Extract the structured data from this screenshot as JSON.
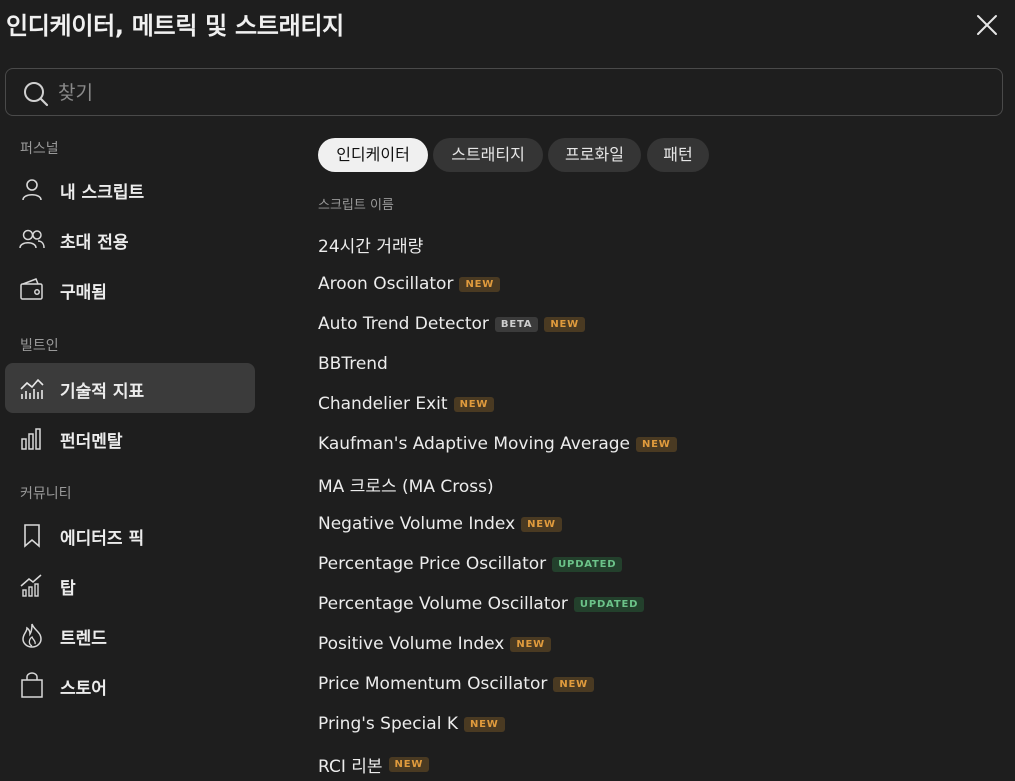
{
  "title": "인디케이터, 메트릭 및 스트래티지",
  "search": {
    "placeholder": "찾기",
    "value": ""
  },
  "sidebar": {
    "personal_heading": "퍼스널",
    "personal_items": [
      {
        "label": "내 스크립트",
        "icon": "user-icon"
      },
      {
        "label": "초대 전용",
        "icon": "users-icon"
      },
      {
        "label": "구매됨",
        "icon": "wallet-icon"
      }
    ],
    "builtin_heading": "빌트인",
    "builtin_items": [
      {
        "label": "기술적 지표",
        "icon": "chart-icon",
        "active": true
      },
      {
        "label": "펀더멘탈",
        "icon": "bars-icon"
      }
    ],
    "community_heading": "커뮤니티",
    "community_items": [
      {
        "label": "에디터즈 픽",
        "icon": "bookmark-icon"
      },
      {
        "label": "탑",
        "icon": "growth-icon"
      },
      {
        "label": "트렌드",
        "icon": "flame-icon"
      },
      {
        "label": "스토어",
        "icon": "bag-icon"
      }
    ]
  },
  "tabs": [
    {
      "label": "인디케이터",
      "active": true
    },
    {
      "label": "스트래티지"
    },
    {
      "label": "프로화일"
    },
    {
      "label": "패턴"
    }
  ],
  "list": {
    "header": "스크립트 이름",
    "rows": [
      {
        "name": "24시간 거래량",
        "badges": []
      },
      {
        "name": "Aroon Oscillator",
        "badges": [
          {
            "text": "NEW",
            "type": "new"
          }
        ]
      },
      {
        "name": "Auto Trend Detector",
        "badges": [
          {
            "text": "BETA",
            "type": "beta"
          },
          {
            "text": "NEW",
            "type": "new"
          }
        ]
      },
      {
        "name": "BBTrend",
        "badges": []
      },
      {
        "name": "Chandelier Exit",
        "badges": [
          {
            "text": "NEW",
            "type": "new"
          }
        ]
      },
      {
        "name": "Kaufman's Adaptive Moving Average",
        "badges": [
          {
            "text": "NEW",
            "type": "new"
          }
        ]
      },
      {
        "name": "MA 크로스 (MA Cross)",
        "badges": []
      },
      {
        "name": "Negative Volume Index",
        "badges": [
          {
            "text": "NEW",
            "type": "new"
          }
        ]
      },
      {
        "name": "Percentage Price Oscillator",
        "badges": [
          {
            "text": "UPDATED",
            "type": "updated"
          }
        ]
      },
      {
        "name": "Percentage Volume Oscillator",
        "badges": [
          {
            "text": "UPDATED",
            "type": "updated"
          }
        ]
      },
      {
        "name": "Positive Volume Index",
        "badges": [
          {
            "text": "NEW",
            "type": "new"
          }
        ]
      },
      {
        "name": "Price Momentum Oscillator",
        "badges": [
          {
            "text": "NEW",
            "type": "new"
          }
        ]
      },
      {
        "name": "Pring's Special K",
        "badges": [
          {
            "text": "NEW",
            "type": "new"
          }
        ]
      },
      {
        "name": "RCI 리본",
        "badges": [
          {
            "text": "NEW",
            "type": "new"
          }
        ]
      }
    ]
  },
  "colors": {
    "background": "#1e1e1e",
    "active_item": "#3b3b3b",
    "badge_new": "#e09b3d",
    "badge_updated": "#6cc389"
  }
}
